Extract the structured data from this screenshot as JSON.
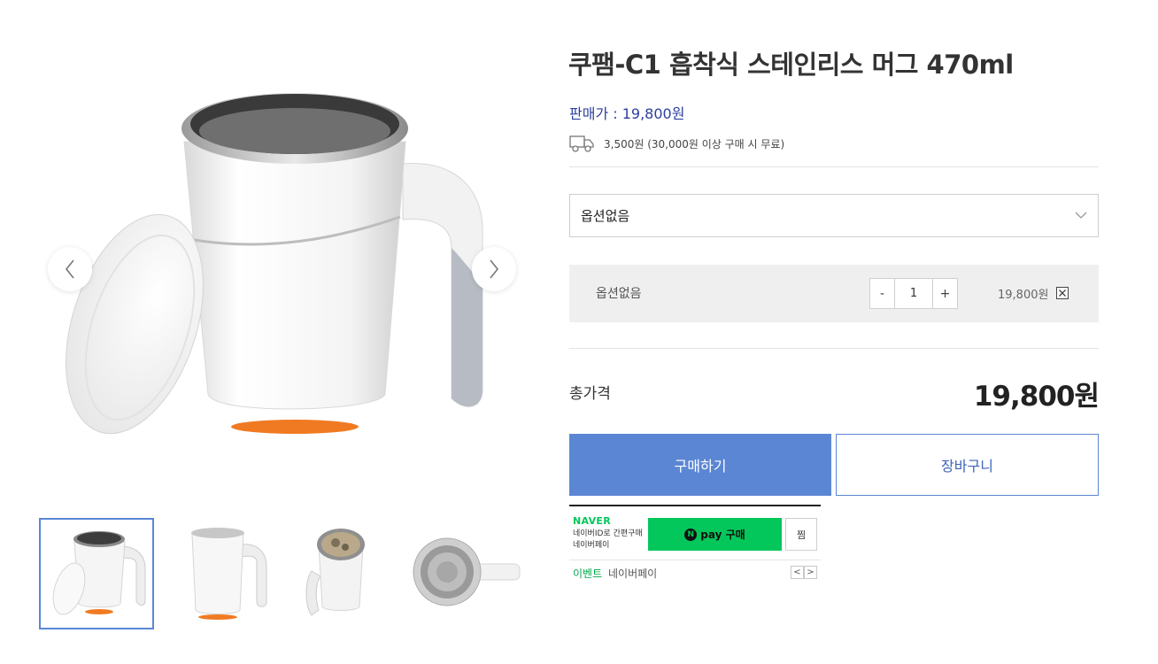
{
  "product": {
    "title": "쿠팸-C1 흡착식 스테인리스 머그 470ml",
    "price_line": "판매가 : 19,800원",
    "shipping_text": "3,500원 (30,000원 이상 구매 시 무료)"
  },
  "option_select": {
    "selected": "옵션없음"
  },
  "selected_option": {
    "name": "옵션없음",
    "minus": "-",
    "quantity": "1",
    "plus": "+",
    "price": "19,800원"
  },
  "total": {
    "label": "총가격",
    "value": "19,800원"
  },
  "actions": {
    "buy": "구매하기",
    "cart": "장바구니"
  },
  "naver_pay": {
    "brand": "NAVER",
    "description": "네이버ID로 간편구매 네이버페이",
    "logo_letter": "N",
    "button_label": "pay 구매",
    "zzim": "찜",
    "event_label": "이벤트",
    "event_text": "네이버페이",
    "prev": "<",
    "next": ">"
  },
  "gallery": {
    "prev_icon": "chevron-left-icon",
    "next_icon": "chevron-right-icon",
    "thumbnails": [
      "mug-with-lid",
      "mug-with-closed-lid",
      "mug-top-view",
      "mug-bottom-view"
    ]
  },
  "colors": {
    "accent_blue": "#5b86d3",
    "price_blue": "#2b3f9e",
    "naver_green": "#03c75a",
    "option_bg": "#efefef"
  }
}
